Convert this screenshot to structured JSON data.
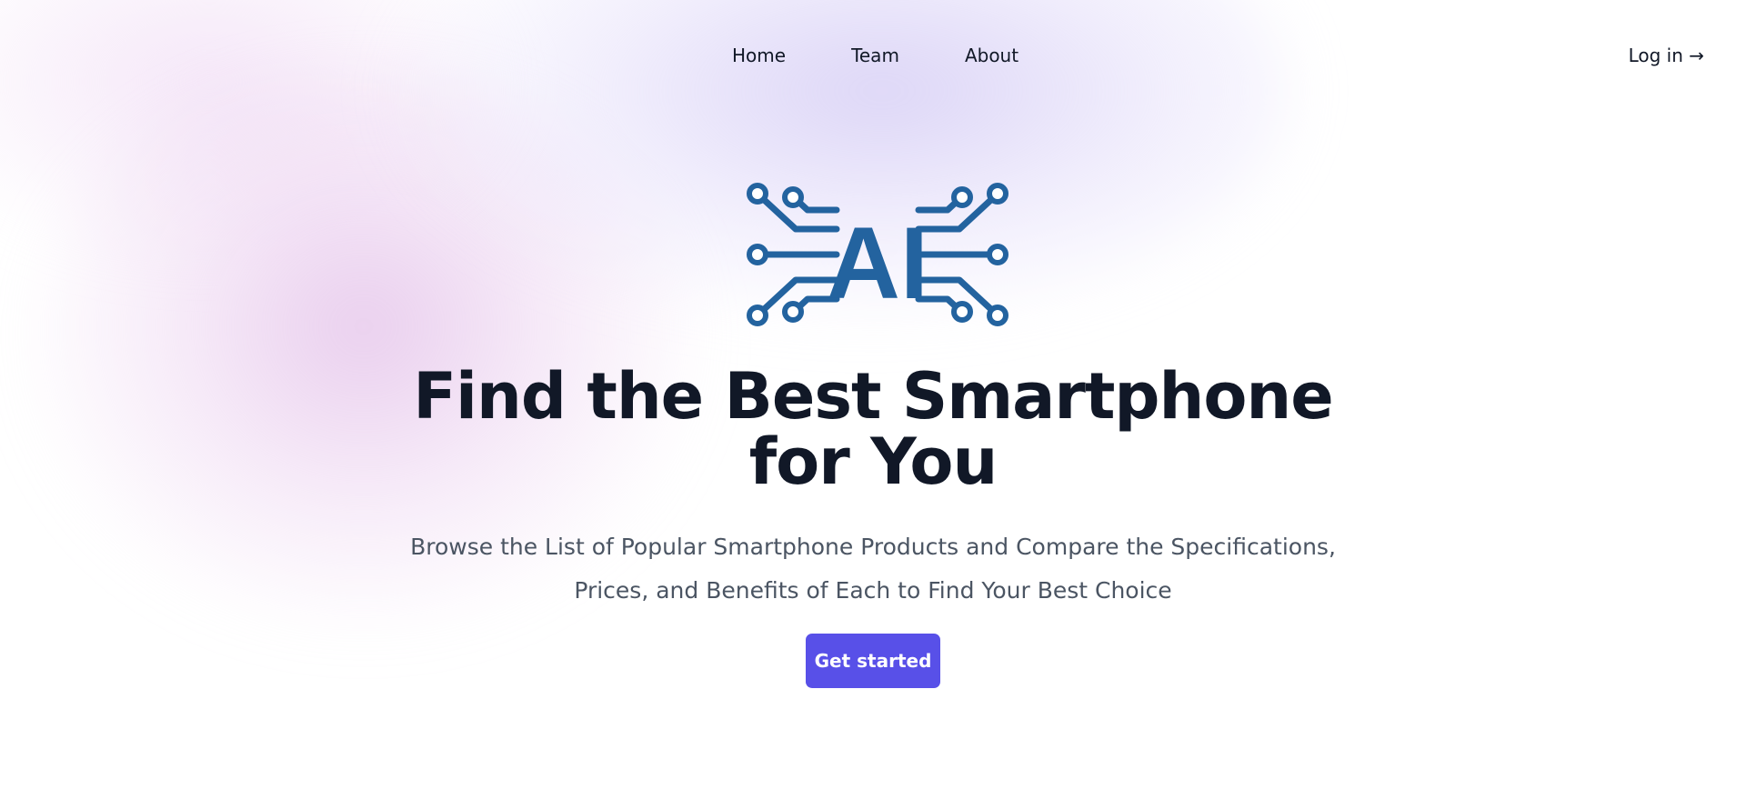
{
  "nav": {
    "links": [
      {
        "label": "Home"
      },
      {
        "label": "Team"
      },
      {
        "label": "About"
      }
    ],
    "login_label": "Log in →"
  },
  "logo": {
    "text": "AI",
    "icon": "circuit-ai-logo",
    "color": "#23639f"
  },
  "hero": {
    "title": "Find the Best Smartphone for You",
    "subtitle": "Browse the List of Popular Smartphone Products and Compare the Specifications, Prices, and Benefits of Each to Find Your Best Choice",
    "cta_label": "Get started"
  },
  "colors": {
    "accent": "#5850e8",
    "heading": "#111827",
    "body_text": "#4b5563",
    "logo_blue": "#23639f"
  }
}
